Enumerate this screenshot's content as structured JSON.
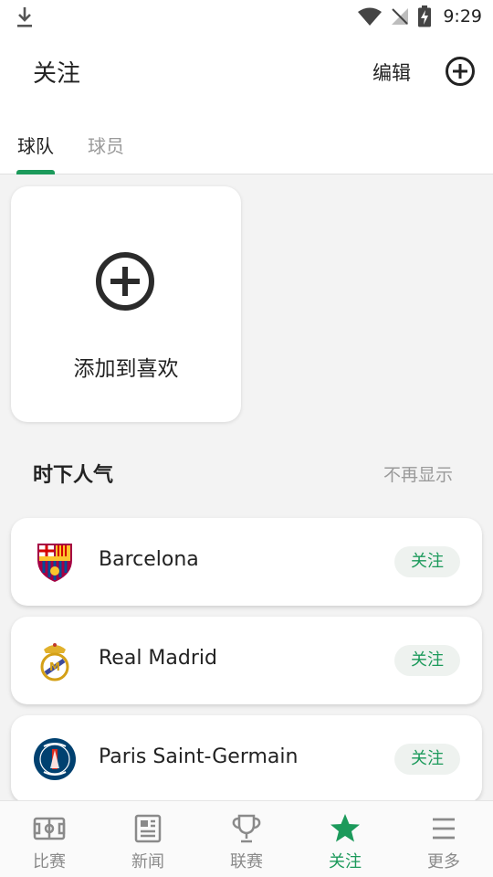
{
  "status_bar": {
    "time": "9:29",
    "icons": [
      "download-icon",
      "wifi-icon",
      "no-signal-icon",
      "battery-charging-icon"
    ]
  },
  "header": {
    "title": "关注",
    "edit_label": "编辑",
    "add_icon": "add-circle-icon"
  },
  "tabs": [
    {
      "label": "球队",
      "active": true
    },
    {
      "label": "球员",
      "active": false
    }
  ],
  "add_card": {
    "label": "添加到喜欢",
    "icon": "add-circle-icon"
  },
  "popular": {
    "title": "时下人气",
    "dismiss_label": "不再显示",
    "teams": [
      {
        "name": "Barcelona",
        "follow_label": "关注",
        "logo": "barcelona-crest-icon"
      },
      {
        "name": "Real Madrid",
        "follow_label": "关注",
        "logo": "real-madrid-crest-icon"
      },
      {
        "name": "Paris Saint-Germain",
        "follow_label": "关注",
        "logo": "psg-crest-icon"
      }
    ]
  },
  "bottom_nav": {
    "items": [
      {
        "label": "比赛",
        "icon": "pitch-icon",
        "active": false
      },
      {
        "label": "新闻",
        "icon": "news-icon",
        "active": false
      },
      {
        "label": "联赛",
        "icon": "trophy-icon",
        "active": false
      },
      {
        "label": "关注",
        "icon": "star-icon",
        "active": true
      },
      {
        "label": "更多",
        "icon": "menu-icon",
        "active": false
      }
    ]
  },
  "colors": {
    "accent": "#1c9a5b",
    "muted_text": "#9a9a9a",
    "background": "#f3f3f3"
  }
}
